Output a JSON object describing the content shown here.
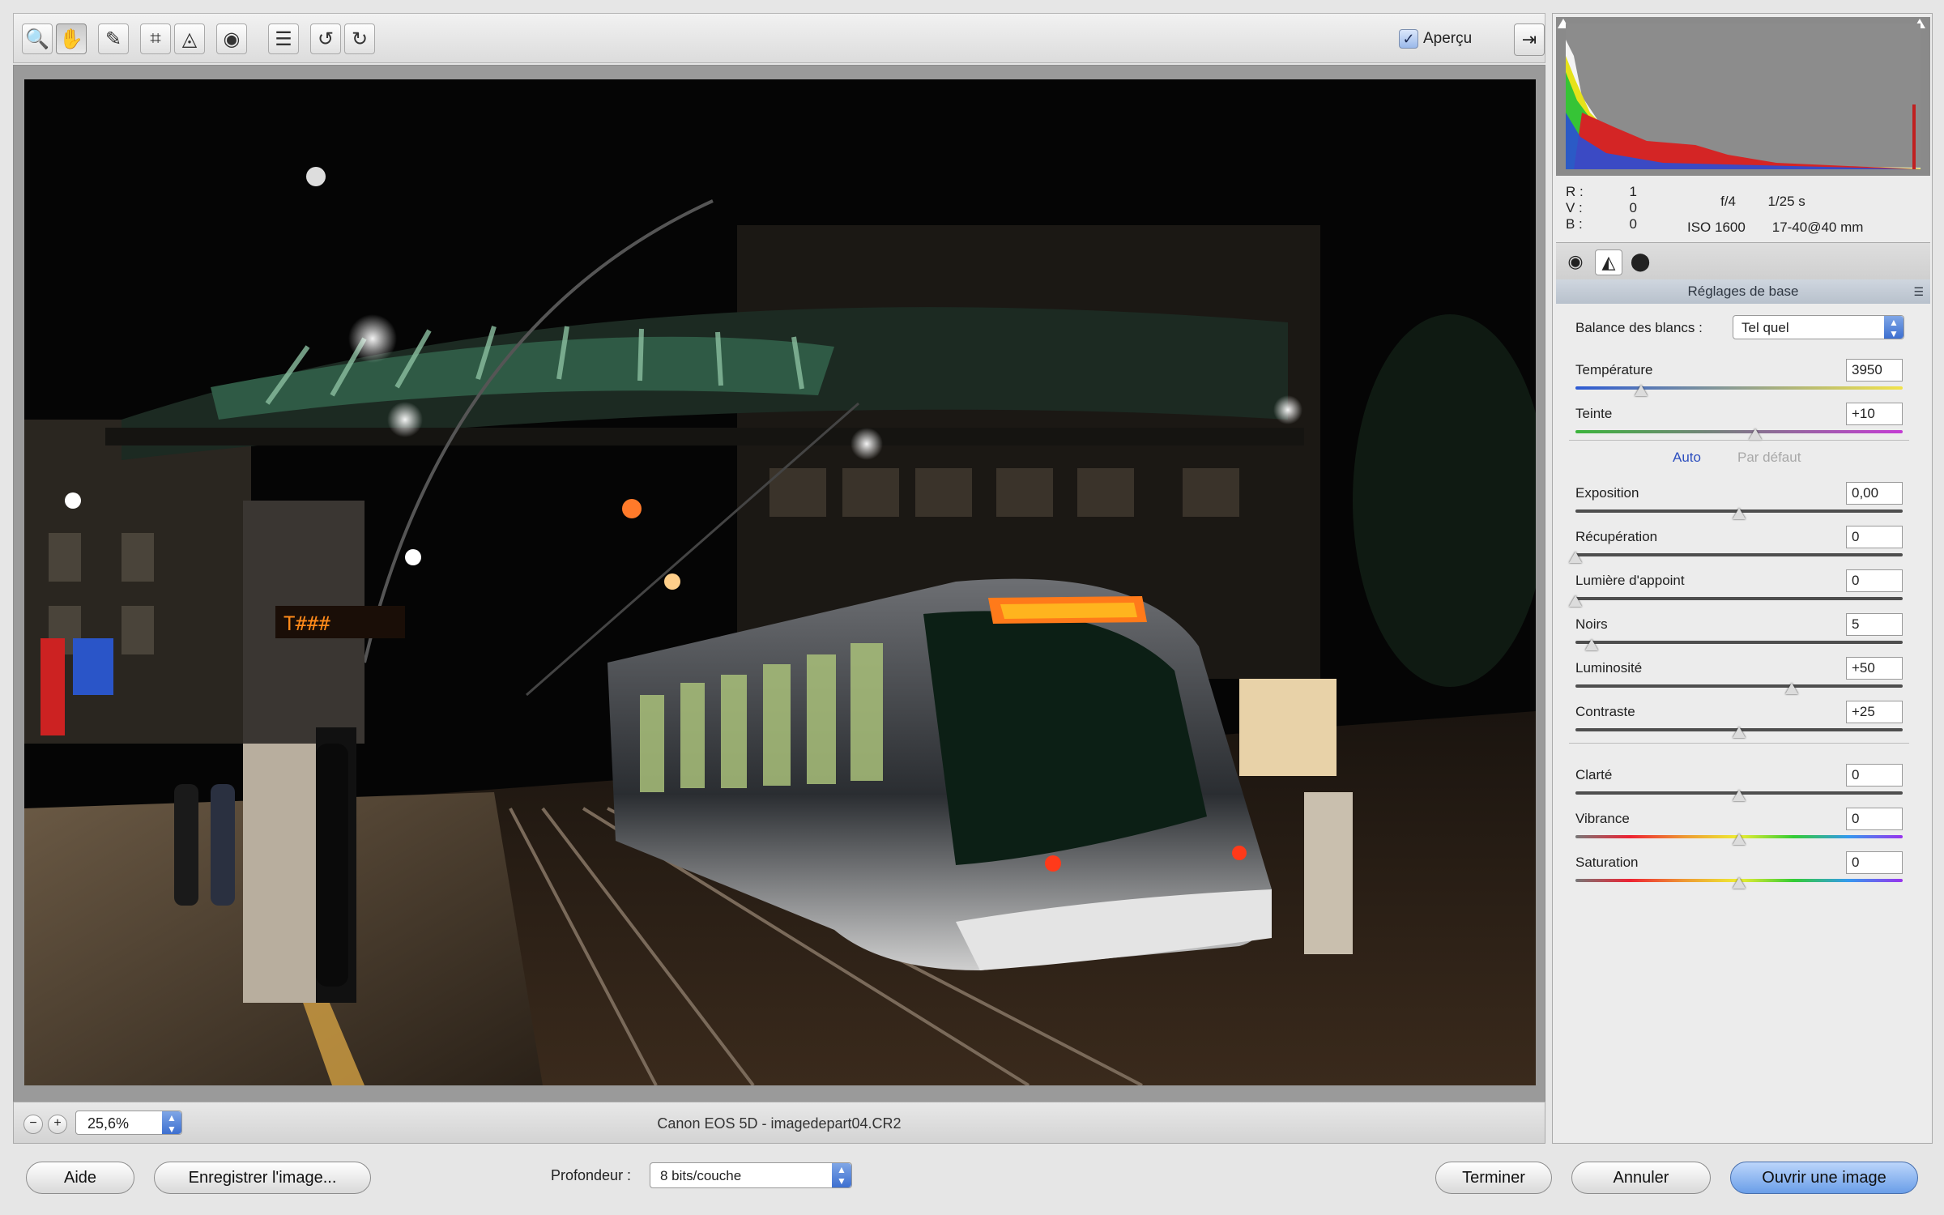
{
  "toolbar": {
    "tools": [
      {
        "icon": "zoom-icon",
        "glyph": "🔍"
      },
      {
        "icon": "hand-icon",
        "glyph": "✋"
      },
      {
        "icon": "white-balance-dropper-icon",
        "glyph": "✎"
      },
      {
        "icon": "crop-icon",
        "glyph": "⌗"
      },
      {
        "icon": "straighten-icon",
        "glyph": "◬"
      },
      {
        "icon": "red-eye-icon",
        "glyph": "◉"
      },
      {
        "icon": "preferences-icon",
        "glyph": "☰"
      },
      {
        "icon": "rotate-left-icon",
        "glyph": "↺"
      },
      {
        "icon": "rotate-right-icon",
        "glyph": "↻"
      }
    ],
    "preview_label": "Aperçu",
    "preview_checked": true
  },
  "histogram": {
    "readout_labels": [
      "R :",
      "V :",
      "B :"
    ],
    "readout_values": [
      "1",
      "0",
      "0"
    ],
    "aperture": "f/4",
    "shutter": "1/25 s",
    "iso": "ISO 1600",
    "lens": "17-40@40 mm"
  },
  "panel": {
    "section_title": "Réglages de base",
    "white_balance_label": "Balance des blancs :",
    "white_balance_value": "Tel quel",
    "auto_label": "Auto",
    "default_label": "Par défaut",
    "sliders": [
      {
        "label": "Température",
        "value": "3950",
        "position": 0.2
      },
      {
        "label": "Teinte",
        "value": "+10",
        "position": 0.55
      },
      {
        "label": "Exposition",
        "value": "0,00",
        "position": 0.5
      },
      {
        "label": "Récupération",
        "value": "0",
        "position": 0.0
      },
      {
        "label": "Lumière d'appoint",
        "value": "0",
        "position": 0.0
      },
      {
        "label": "Noirs",
        "value": "5",
        "position": 0.05
      },
      {
        "label": "Luminosité",
        "value": "+50",
        "position": 0.66
      },
      {
        "label": "Contraste",
        "value": "+25",
        "position": 0.5
      },
      {
        "label": "Clarté",
        "value": "0",
        "position": 0.5
      },
      {
        "label": "Vibrance",
        "value": "0",
        "position": 0.5
      },
      {
        "label": "Saturation",
        "value": "0",
        "position": 0.5
      }
    ]
  },
  "status": {
    "zoom": "25,6%",
    "file_info": "Canon EOS 5D  -  imagedepart04.CR2"
  },
  "footer": {
    "help": "Aide",
    "save_image": "Enregistrer l'image...",
    "depth_label": "Profondeur :",
    "depth_value": "8 bits/couche",
    "done": "Terminer",
    "cancel": "Annuler",
    "open_image": "Ouvrir une image"
  },
  "colors": {
    "accent": "#6a9ee8",
    "link": "#2d4fbf"
  }
}
